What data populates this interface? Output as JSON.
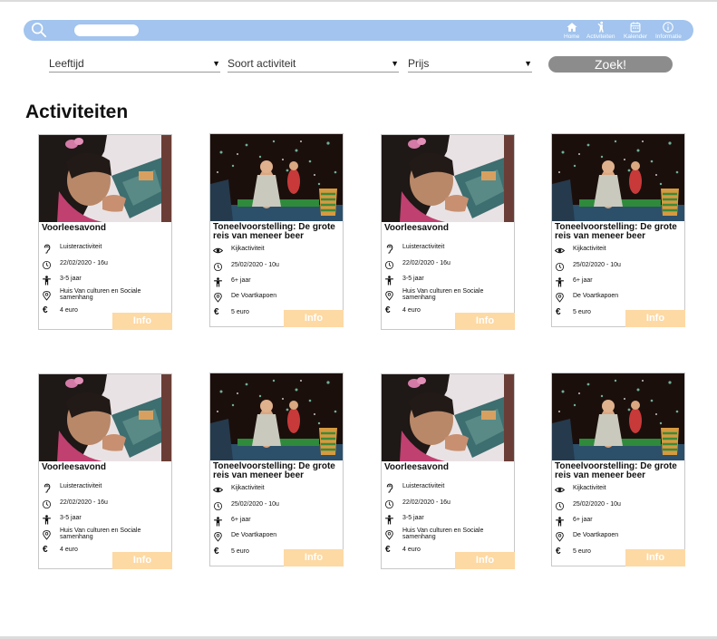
{
  "header": {
    "search_placeholder": "",
    "nav": [
      {
        "label": "Home",
        "icon": "home-icon"
      },
      {
        "label": "Activiteiten",
        "icon": "activity-person-icon"
      },
      {
        "label": "Kalender",
        "icon": "calendar-icon"
      },
      {
        "label": "Informatie",
        "icon": "info-icon"
      }
    ]
  },
  "filters": {
    "age": "Leeftijd",
    "type": "Soort activiteit",
    "price": "Prijs",
    "search_button": "Zoek!"
  },
  "page_title": "Activiteiten",
  "colors": {
    "topbar": "#a2c4ee",
    "search_button": "#8c8c8c",
    "info_button": "#fdd9a4"
  },
  "cards": [
    {
      "title": "Voorleesavond",
      "kind": "Luisteractiviteit",
      "date": "22/02/2020 - 16u",
      "age": "3-5 jaar",
      "location": "Huis Van culturen en Sociale samenhang",
      "price": "4 euro",
      "info": "Info"
    },
    {
      "title": "Toneelvoorstelling: De grote reis van meneer beer",
      "kind": "Kijkactiviteit",
      "date": "25/02/2020 - 10u",
      "age": "6+ jaar",
      "location": "De Voartkapoen",
      "price": "5 euro",
      "info": "Info"
    },
    {
      "title": "Voorleesavond",
      "kind": "Luisteractiviteit",
      "date": "22/02/2020 - 16u",
      "age": "3-5 jaar",
      "location": "Huis Van culturen en Sociale samenhang",
      "price": "4 euro",
      "info": "Info"
    },
    {
      "title": "Toneelvoorstelling: De grote reis van meneer beer",
      "kind": "Kijkactiviteit",
      "date": "25/02/2020 - 10u",
      "age": "6+ jaar",
      "location": "De Voartkapoen",
      "price": "5 euro",
      "info": "Info"
    },
    {
      "title": "Voorleesavond",
      "kind": "Luisteractiviteit",
      "date": "22/02/2020 - 16u",
      "age": "3-5 jaar",
      "location": "Huis Van culturen en Sociale samenhang",
      "price": "4 euro",
      "info": "Info"
    },
    {
      "title": "Toneelvoorstelling: De grote reis van meneer beer",
      "kind": "Kijkactiviteit",
      "date": "25/02/2020 - 10u",
      "age": "6+ jaar",
      "location": "De Voartkapoen",
      "price": "5 euro",
      "info": "Info"
    },
    {
      "title": "Voorleesavond",
      "kind": "Luisteractiviteit",
      "date": "22/02/2020 - 16u",
      "age": "3-5 jaar",
      "location": "Huis Van culturen en Sociale samenhang",
      "price": "4 euro",
      "info": "Info"
    },
    {
      "title": "Toneelvoorstelling: De grote reis van meneer beer",
      "kind": "Kijkactiviteit",
      "date": "25/02/2020 - 10u",
      "age": "6+ jaar",
      "location": "De Voartkapoen",
      "price": "5 euro",
      "info": "Info"
    }
  ]
}
